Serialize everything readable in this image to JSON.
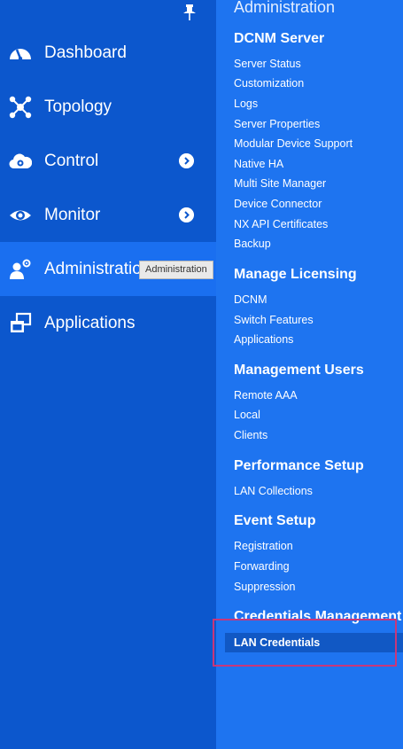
{
  "sidebar": {
    "items": [
      {
        "label": "Dashboard",
        "icon": "dashboard-icon"
      },
      {
        "label": "Topology",
        "icon": "topology-icon"
      },
      {
        "label": "Control",
        "icon": "control-icon",
        "has_submenu": true
      },
      {
        "label": "Monitor",
        "icon": "monitor-icon",
        "has_submenu": true
      },
      {
        "label": "Administration",
        "icon": "administration-icon",
        "active": true
      },
      {
        "label": "Applications",
        "icon": "applications-icon"
      }
    ],
    "pin_icon": "pin-icon"
  },
  "tooltip": {
    "text": "Administration"
  },
  "submenu": {
    "title": "Administration",
    "sections": [
      {
        "title": "DCNM Server",
        "items": [
          "Server Status",
          "Customization",
          "Logs",
          "Server Properties",
          "Modular Device Support",
          "Native HA",
          "Multi Site Manager",
          "Device Connector",
          "NX API Certificates",
          "Backup"
        ]
      },
      {
        "title": "Manage Licensing",
        "items": [
          "DCNM",
          "Switch Features",
          "Applications"
        ]
      },
      {
        "title": "Management Users",
        "items": [
          "Remote AAA",
          "Local",
          "Clients"
        ]
      },
      {
        "title": "Performance Setup",
        "items": [
          "LAN Collections"
        ]
      },
      {
        "title": "Event Setup",
        "items": [
          "Registration",
          "Forwarding",
          "Suppression"
        ]
      },
      {
        "title": "Credentials Management",
        "items": [
          "LAN Credentials"
        ]
      }
    ],
    "selected_item": "LAN Credentials"
  },
  "colors": {
    "sidebar_bg": "#0c57cd",
    "sidebar_active": "#1a6ff0",
    "submenu_bg": "#1e74f0",
    "selected_item_bg": "#1158c4",
    "highlight_border": "#c8377a"
  }
}
